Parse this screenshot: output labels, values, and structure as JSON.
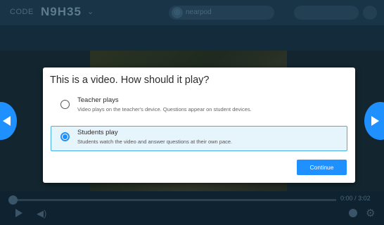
{
  "topbar": {
    "code_label": "CODE",
    "code_value": "N9H35",
    "code_caret": "⌄",
    "logo_glyph": "◎",
    "logo_text": "nearpod"
  },
  "modal": {
    "title": "This is a video. How should it play?",
    "options": [
      {
        "title": "Teacher plays",
        "description": "Video plays on the teacher's device. Questions appear on student devices.",
        "selected": false
      },
      {
        "title": "Students play",
        "description": "Students watch the video and answer questions at their own pace.",
        "selected": true
      }
    ],
    "continue_label": "Continue"
  },
  "player": {
    "time_current": "0:00",
    "time_separator": "/",
    "time_total": "3:02",
    "progress_fraction": 0
  },
  "colors": {
    "accent": "#1e90ff",
    "selected_bg": "#e6f4fc",
    "selected_border": "#4aaee6"
  },
  "icons": {
    "nav_left": "arrow-left-icon",
    "nav_right": "arrow-right-icon",
    "play": "play-icon",
    "volume": "volume-icon",
    "record": "record-icon",
    "settings": "gear-icon"
  }
}
